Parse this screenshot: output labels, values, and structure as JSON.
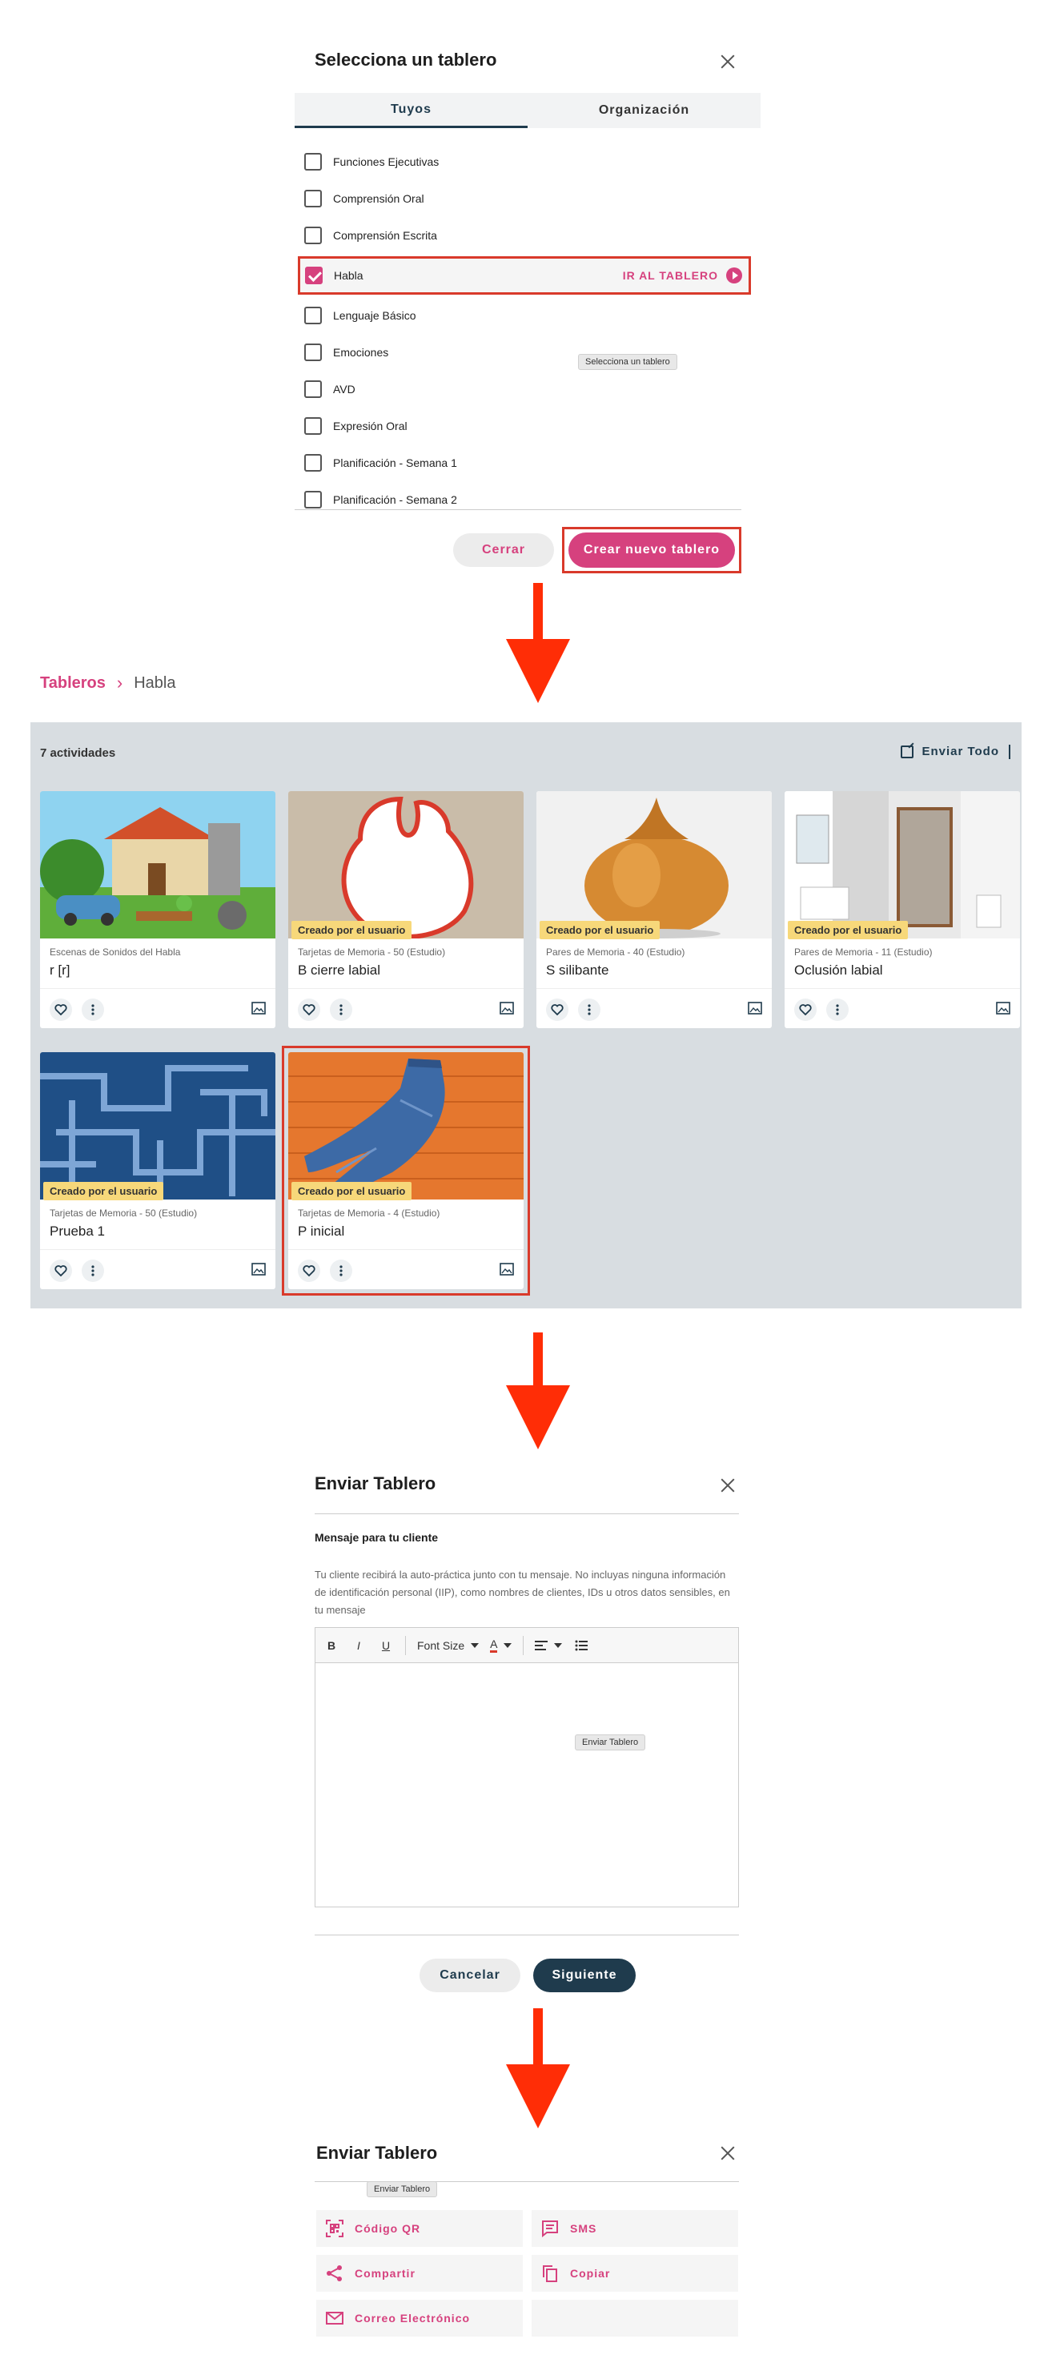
{
  "select_board": {
    "title": "Selecciona un tablero",
    "tabs": [
      {
        "label": "Tuyos"
      },
      {
        "label": "Organización"
      }
    ],
    "boards": [
      {
        "label": "Funciones Ejecutivas",
        "checked": false
      },
      {
        "label": "Comprensión Oral",
        "checked": false
      },
      {
        "label": "Comprensión Escrita",
        "checked": false
      },
      {
        "label": "Habla",
        "checked": true
      },
      {
        "label": "Lenguaje Básico",
        "checked": false
      },
      {
        "label": "Emociones",
        "checked": false
      },
      {
        "label": "AVD",
        "checked": false
      },
      {
        "label": "Expresión Oral",
        "checked": false
      },
      {
        "label": "Planificación - Semana 1",
        "checked": false
      },
      {
        "label": "Planificación - Semana 2",
        "checked": false
      }
    ],
    "go_to_board_label": "IR AL TABLERO",
    "tooltip": "Selecciona un tablero",
    "close_label": "Cerrar",
    "create_label": "Crear nuevo tablero"
  },
  "boards_page": {
    "breadcrumb": {
      "root": "Tableros",
      "current": "Habla"
    },
    "activity_count": "7 actividades",
    "send_all_label": "Enviar Todo",
    "cards": [
      {
        "category": "Escenas de Sonidos del Habla",
        "title": "r [r]",
        "badge": ""
      },
      {
        "category": "Tarjetas de Memoria - 50 (Estudio)",
        "title": "B cierre labial",
        "badge": "Creado por el usuario"
      },
      {
        "category": "Pares de Memoria - 40 (Estudio)",
        "title": "S silibante",
        "badge": "Creado por el usuario"
      },
      {
        "category": "Pares de Memoria - 11 (Estudio)",
        "title": "Oclusión labial",
        "badge": "Creado por el usuario"
      },
      {
        "category": "Tarjetas de Memoria - 50 (Estudio)",
        "title": "Prueba 1",
        "badge": "Creado por el usuario"
      },
      {
        "category": "Tarjetas de Memoria - 4 (Estudio)",
        "title": "P inicial",
        "badge": "Creado por el usuario"
      }
    ]
  },
  "send_board_message": {
    "title": "Enviar Tablero",
    "message_label": "Mensaje para tu cliente",
    "help_text": "Tu cliente recibirá la auto-práctica junto con tu mensaje. No incluyas ninguna información de identificación personal (IIP), como nombres de clientes, IDs u otros datos sensibles, en tu mensaje",
    "toolbar": {
      "bold": "B",
      "italic": "I",
      "underline": "U",
      "font_size": "Font Size",
      "font_color": "A"
    },
    "tooltip": "Enviar Tablero",
    "cancel_label": "Cancelar",
    "next_label": "Siguiente"
  },
  "send_board_options": {
    "title": "Enviar Tablero",
    "tooltip": "Enviar Tablero",
    "options": [
      {
        "label": "Código QR",
        "icon": "qr-code-icon"
      },
      {
        "label": "SMS",
        "icon": "message-icon"
      },
      {
        "label": "Compartir",
        "icon": "share-icon"
      },
      {
        "label": "Copiar",
        "icon": "copy-icon"
      },
      {
        "label": "Correo Electrónico",
        "icon": "mail-icon"
      }
    ]
  },
  "colors": {
    "accent_pink": "#d6417e",
    "dark_navy": "#1f3b4d",
    "highlight_red": "#d93a2b",
    "arrow_red": "#ff2d06",
    "badge_yellow": "#f7d87a",
    "panel_grey": "#d8dde1"
  }
}
